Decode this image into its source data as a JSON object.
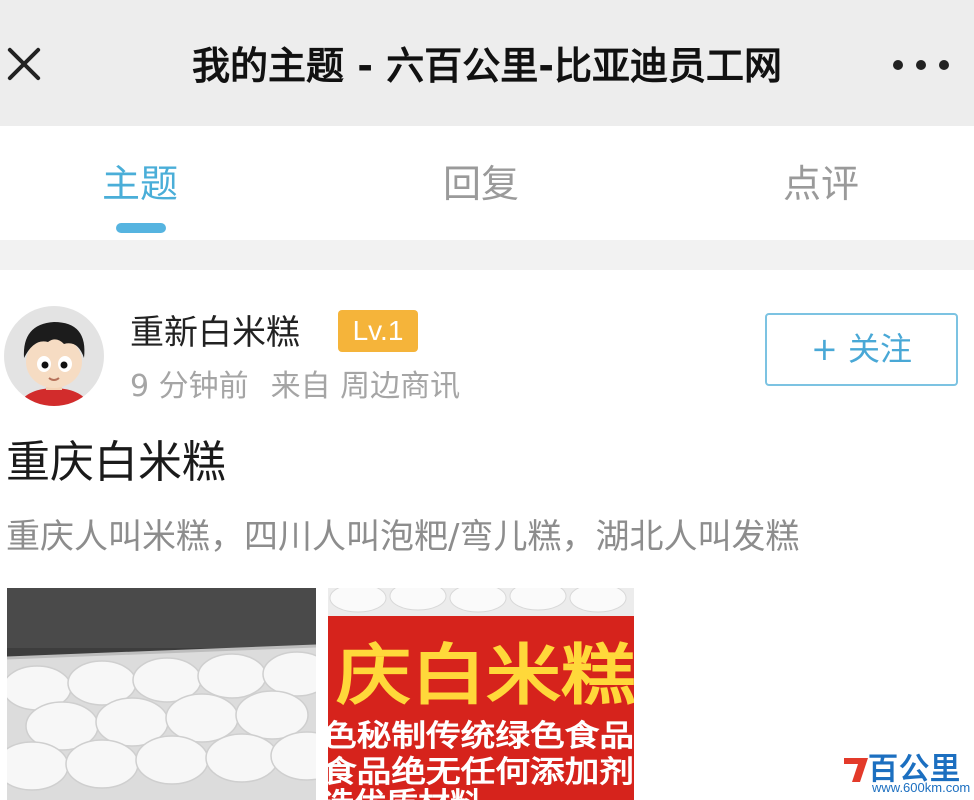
{
  "header": {
    "title": "我的主题 - 六百公里-比亚迪员工网",
    "close_icon": "close-icon",
    "more_icon": "more-icon"
  },
  "tabs": [
    {
      "label": "主题",
      "active": true
    },
    {
      "label": "回复",
      "active": false
    },
    {
      "label": "点评",
      "active": false
    }
  ],
  "post": {
    "author": "重新白米糕",
    "level": "Lv.1",
    "time": "9 分钟前",
    "source": "来自 周边商讯",
    "follow_label": "+ 关注",
    "title": "重庆白米糕",
    "summary": "重庆人叫米糕，四川人叫泡粑/弯儿糕，湖北人叫发糕",
    "images": [
      {
        "description_icon": "rice-cake-tray-image"
      },
      {
        "sign_lines": [
          "庆白米糕",
          "色秘制传统绿色食品",
          "食品绝无任何添加剂",
          "选优质材料"
        ]
      }
    ]
  },
  "watermark": {
    "name": "百公里",
    "url": "www.600km.com"
  },
  "colors": {
    "accent": "#4aaed8",
    "level_badge": "#f5b43a",
    "header_bg": "#ededed",
    "sign_red": "#d6231c",
    "sign_yellow": "#ffd83a"
  }
}
